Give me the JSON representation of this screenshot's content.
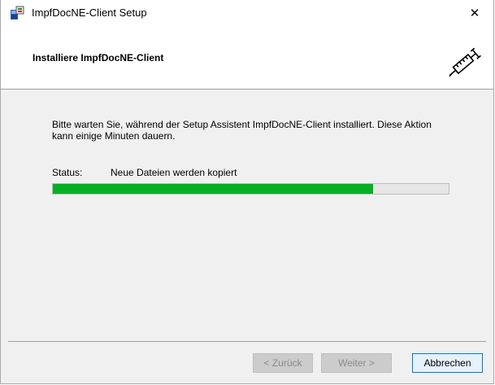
{
  "window": {
    "title": "ImpfDocNE-Client Setup",
    "close_glyph": "✕"
  },
  "header": {
    "title": "Installiere ImpfDocNE-Client",
    "icon": "syringe-icon"
  },
  "content": {
    "description": "Bitte warten Sie, während der Setup Assistent ImpfDocNE-Client installiert. Diese Aktion kann einige Minuten dauern.",
    "status_label": "Status:",
    "status_value": "Neue Dateien werden kopiert",
    "progress_fraction": 0.81,
    "progress_color": "#06b025"
  },
  "buttons": {
    "back": "< Zurück",
    "next": "Weiter >",
    "cancel": "Abbrechen"
  }
}
